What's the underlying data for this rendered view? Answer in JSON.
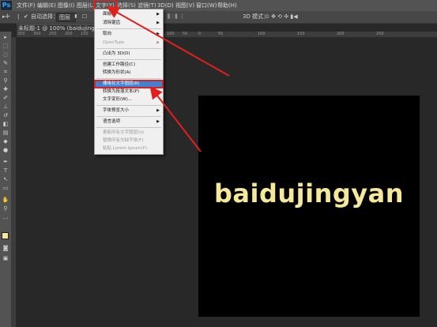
{
  "app": {
    "logo": "Ps"
  },
  "menubar": [
    {
      "label": "文件(F)",
      "active": false
    },
    {
      "label": "编辑(E)",
      "active": false
    },
    {
      "label": "图像(I)",
      "active": false
    },
    {
      "label": "图层(L)",
      "active": false
    },
    {
      "label": "文字(Y)",
      "active": true
    },
    {
      "label": "选择(S)",
      "active": false
    },
    {
      "label": "滤镜(T)",
      "active": false
    },
    {
      "label": "3D(D)",
      "active": false
    },
    {
      "label": "视图(V)",
      "active": false
    },
    {
      "label": "窗口(W)",
      "active": false
    },
    {
      "label": "帮助(H)",
      "active": false
    }
  ],
  "options": {
    "auto_select_label": "自动选择：",
    "auto_select_value": "图层",
    "mode_label": "3D 模式："
  },
  "document": {
    "tab_title": "未标题-1 @ 100% (baidujingyan, RGB..."
  },
  "ruler": {
    "ticks": [
      "350",
      "300",
      "250",
      "200",
      "150",
      "100",
      "50",
      "0",
      "50",
      "100",
      "150",
      "200",
      "250"
    ]
  },
  "canvas": {
    "text": "baidujingyan",
    "text_color": "#f5e89a",
    "background": "#000000"
  },
  "type_menu": {
    "items": [
      {
        "label": "面板",
        "submenu": true,
        "disabled": false
      },
      {
        "label": "消除锯齿",
        "submenu": true,
        "disabled": false
      },
      {
        "sep": true
      },
      {
        "label": "取向",
        "submenu": true,
        "disabled": false
      },
      {
        "label": "OpenType",
        "submenu": true,
        "disabled": true
      },
      {
        "sep": true
      },
      {
        "label": "凸出为 3D(D)",
        "submenu": false,
        "disabled": false
      },
      {
        "sep": true
      },
      {
        "label": "创建工作路径(C)",
        "submenu": false,
        "disabled": false
      },
      {
        "label": "转换为形状(A)",
        "submenu": false,
        "disabled": false
      },
      {
        "sep": true
      },
      {
        "label": "栅格化文字图层(R)",
        "submenu": false,
        "disabled": false,
        "highlight": true
      },
      {
        "label": "转换为段落文本(P)",
        "submenu": false,
        "disabled": false
      },
      {
        "label": "文字变形(W)...",
        "submenu": false,
        "disabled": false
      },
      {
        "sep": true
      },
      {
        "label": "字体预览大小",
        "submenu": true,
        "disabled": false
      },
      {
        "sep": true
      },
      {
        "label": "语言选项",
        "submenu": true,
        "disabled": false
      },
      {
        "sep": true
      },
      {
        "label": "更新所有文字图层(U)",
        "submenu": false,
        "disabled": true
      },
      {
        "label": "替换所有欠缺字体(F)",
        "submenu": false,
        "disabled": true
      },
      {
        "label": "粘贴 Lorem Ipsum(P)",
        "submenu": false,
        "disabled": true
      }
    ]
  },
  "colors": {
    "accent": "#e1201c",
    "highlight": "#3a83d6",
    "foreground_swatch": "#f5e89a",
    "background_swatch": "#ffffff"
  }
}
